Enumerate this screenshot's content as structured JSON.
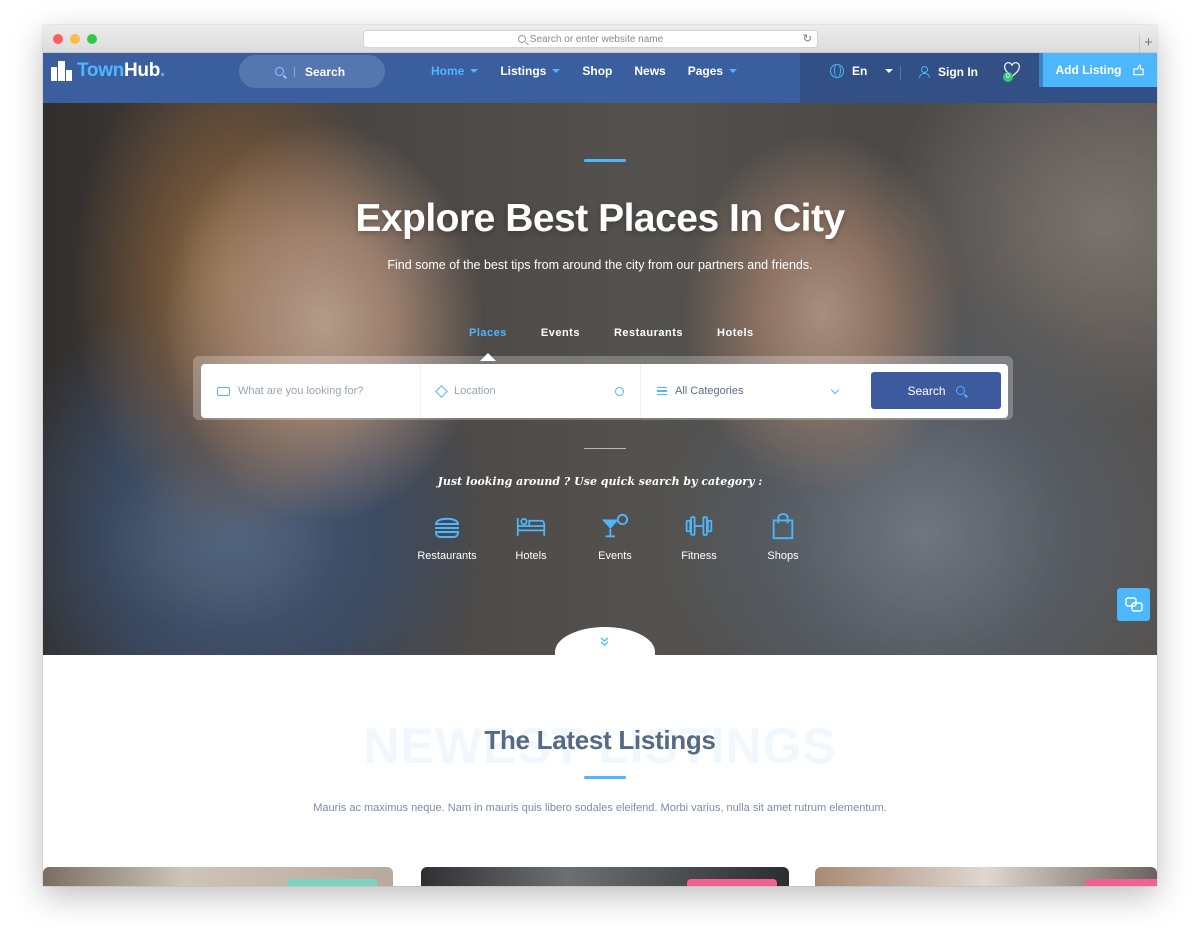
{
  "browser": {
    "url_placeholder": "Search or enter website name",
    "reload_glyph": "↻",
    "newtab_glyph": "+"
  },
  "header": {
    "logo": {
      "part1": "Town",
      "part2": "Hub",
      "dot": "."
    },
    "search_label": "Search",
    "nav": [
      {
        "label": "Home",
        "dropdown": true,
        "active": true
      },
      {
        "label": "Listings",
        "dropdown": true,
        "active": false
      },
      {
        "label": "Shop",
        "dropdown": false,
        "active": false
      },
      {
        "label": "News",
        "dropdown": false,
        "active": false
      },
      {
        "label": "Pages",
        "dropdown": true,
        "active": false
      }
    ],
    "language": "En",
    "signin_label": "Sign In",
    "wishlist_count": "0",
    "add_listing_label": "Add Listing"
  },
  "hero": {
    "title": "Explore Best Places In City",
    "subtitle": "Find some of the best tips from around the city from our partners and friends.",
    "tabs": [
      "Places",
      "Events",
      "Restaurants",
      "Hotels"
    ],
    "active_tab": "Places",
    "search": {
      "keyword_placeholder": "What are you looking for?",
      "location_placeholder": "Location",
      "category_value": "All Categories",
      "button_label": "Search"
    },
    "quick_label": "Just looking around ? Use quick search by category :",
    "categories": [
      {
        "label": "Restaurants",
        "icon": "burger-icon"
      },
      {
        "label": "Hotels",
        "icon": "bed-icon"
      },
      {
        "label": "Events",
        "icon": "cocktail-icon"
      },
      {
        "label": "Fitness",
        "icon": "dumbbell-icon"
      },
      {
        "label": "Shops",
        "icon": "shopping-bag-icon"
      }
    ]
  },
  "section": {
    "ghost_text": "NEWEST LISTINGS",
    "title": "The Latest Listings",
    "description": "Mauris ac maximus neque. Nam in mauris quis libero sodales eleifend. Morbi varius, nulla sit amet rutrum elementum."
  },
  "colors": {
    "accent": "#4db7fe",
    "header_bg": "#3b5f9e",
    "button_dark": "#3d5a9e",
    "title_gray": "#566985"
  }
}
